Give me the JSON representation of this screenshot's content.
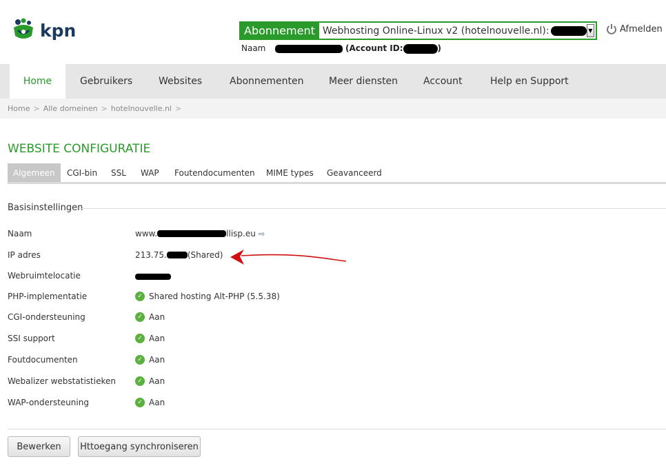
{
  "brand": {
    "logo_text": "kpn"
  },
  "subscription": {
    "label": "Abonnement",
    "value_prefix": "Webhosting Online-Linux v2 (hotelnouvelle.nl): "
  },
  "account": {
    "naam_label": "Naam",
    "account_id_label": "(Account ID:",
    "close_paren": ")"
  },
  "logout_label": "Afmelden",
  "nav": {
    "items": [
      {
        "label": "Home",
        "active": true
      },
      {
        "label": "Gebruikers"
      },
      {
        "label": "Websites"
      },
      {
        "label": "Abonnementen"
      },
      {
        "label": "Meer diensten"
      },
      {
        "label": "Account"
      },
      {
        "label": "Help en Support"
      }
    ]
  },
  "breadcrumb": [
    "Home",
    "Alle domeinen",
    "hotelnouvelle.nl"
  ],
  "page_title": "WEBSITE CONFIGURATIE",
  "tabs": [
    "Algemeen",
    "CGI-bin",
    "SSL",
    "WAP",
    "Foutendocumenten",
    "MIME types",
    "Geavanceerd"
  ],
  "section_title": "Basisinstellingen",
  "settings": {
    "naam": {
      "label": "Naam",
      "prefix": "www.",
      "suffix": "llisp.eu"
    },
    "ip": {
      "label": "IP adres",
      "prefix": "213.75.",
      "suffix": "(Shared)"
    },
    "webruimte": {
      "label": "Webruimtelocatie"
    },
    "php": {
      "label": "PHP-implementatie",
      "value": "Shared hosting Alt-PHP (5.5.38)"
    },
    "cgi": {
      "label": "CGI-ondersteuning",
      "value": "Aan"
    },
    "ssi": {
      "label": "SSI support",
      "value": "Aan"
    },
    "fout": {
      "label": "Foutdocumenten",
      "value": "Aan"
    },
    "webalizer": {
      "label": "Webalizer webstatistieken",
      "value": "Aan"
    },
    "wap": {
      "label": "WAP-ondersteuning",
      "value": "Aan"
    }
  },
  "buttons": {
    "edit": "Bewerken",
    "sync": "Httoegang synchroniseren"
  },
  "colors": {
    "accent": "#2a9a2a",
    "check": "#5cb040",
    "annotation": "#d01010"
  }
}
